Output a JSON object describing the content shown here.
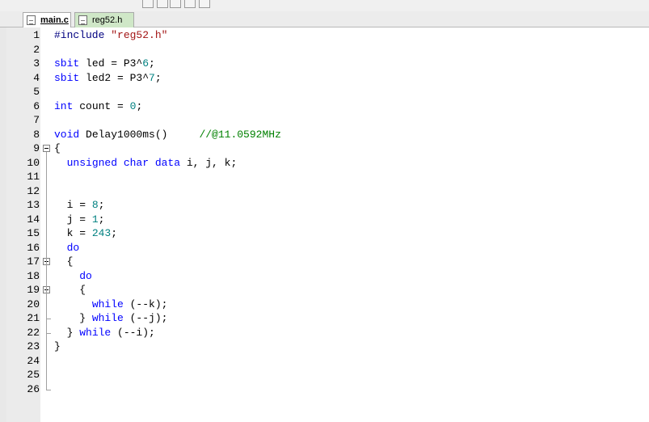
{
  "tabs": [
    {
      "label": "main.c",
      "active": true
    },
    {
      "label": "reg52.h",
      "active": false
    }
  ],
  "editor": {
    "lines": [
      [
        {
          "t": "#include ",
          "c": "pp"
        },
        {
          "t": "\"reg52.h\"",
          "c": "s"
        }
      ],
      [],
      [
        {
          "t": "sbit ",
          "c": "k"
        },
        {
          "t": "led = P3^",
          "c": "p"
        },
        {
          "t": "6",
          "c": "n"
        },
        {
          "t": ";",
          "c": "p"
        }
      ],
      [
        {
          "t": "sbit ",
          "c": "k"
        },
        {
          "t": "led2 = P3^",
          "c": "p"
        },
        {
          "t": "7",
          "c": "n"
        },
        {
          "t": ";",
          "c": "p"
        }
      ],
      [],
      [
        {
          "t": "int ",
          "c": "k"
        },
        {
          "t": "count = ",
          "c": "p"
        },
        {
          "t": "0",
          "c": "n"
        },
        {
          "t": ";",
          "c": "p"
        }
      ],
      [],
      [
        {
          "t": "void ",
          "c": "k"
        },
        {
          "t": "Delay1000ms()     ",
          "c": "p"
        },
        {
          "t": "//@11.0592MHz",
          "c": "c"
        }
      ],
      [
        {
          "t": "{",
          "c": "p"
        }
      ],
      [
        {
          "t": "  ",
          "c": "p"
        },
        {
          "t": "unsigned char data ",
          "c": "k"
        },
        {
          "t": "i, j, k;",
          "c": "p"
        }
      ],
      [],
      [],
      [
        {
          "t": "  i = ",
          "c": "p"
        },
        {
          "t": "8",
          "c": "n"
        },
        {
          "t": ";",
          "c": "p"
        }
      ],
      [
        {
          "t": "  j = ",
          "c": "p"
        },
        {
          "t": "1",
          "c": "n"
        },
        {
          "t": ";",
          "c": "p"
        }
      ],
      [
        {
          "t": "  k = ",
          "c": "p"
        },
        {
          "t": "243",
          "c": "n"
        },
        {
          "t": ";",
          "c": "p"
        }
      ],
      [
        {
          "t": "  ",
          "c": "p"
        },
        {
          "t": "do",
          "c": "k"
        }
      ],
      [
        {
          "t": "  {",
          "c": "p"
        }
      ],
      [
        {
          "t": "    ",
          "c": "p"
        },
        {
          "t": "do",
          "c": "k"
        }
      ],
      [
        {
          "t": "    {",
          "c": "p"
        }
      ],
      [
        {
          "t": "      ",
          "c": "p"
        },
        {
          "t": "while ",
          "c": "k"
        },
        {
          "t": "(--k);",
          "c": "p"
        }
      ],
      [
        {
          "t": "    } ",
          "c": "p"
        },
        {
          "t": "while ",
          "c": "k"
        },
        {
          "t": "(--j);",
          "c": "p"
        }
      ],
      [
        {
          "t": "  } ",
          "c": "p"
        },
        {
          "t": "while ",
          "c": "k"
        },
        {
          "t": "(--i);",
          "c": "p"
        }
      ],
      [
        {
          "t": "}",
          "c": "p"
        }
      ],
      [],
      [],
      []
    ],
    "line_numbers": [
      "1",
      "2",
      "3",
      "4",
      "5",
      "6",
      "7",
      "8",
      "9",
      "10",
      "11",
      "12",
      "13",
      "14",
      "15",
      "16",
      "17",
      "18",
      "19",
      "20",
      "21",
      "22",
      "23",
      "24",
      "25",
      "26"
    ]
  }
}
